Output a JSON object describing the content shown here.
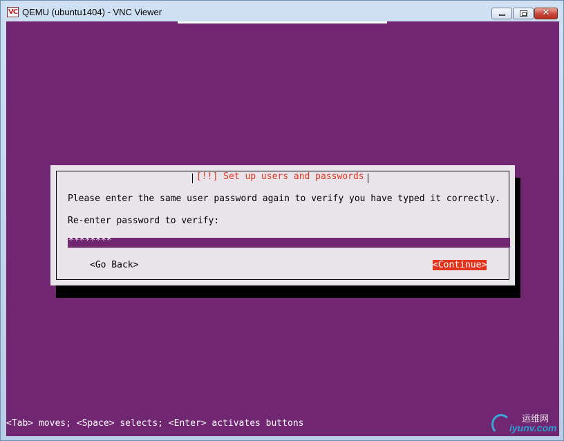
{
  "window": {
    "app_icon_text": "VC",
    "title": "QEMU (ubuntu1404) - VNC Viewer",
    "controls": {
      "minimize": "minimize",
      "maximize": "maximize",
      "close": "✕"
    }
  },
  "dialog": {
    "title": "[!!] Set up users and passwords",
    "prompt": "Please enter the same user password again to verify you have typed it correctly.",
    "field_label": "Re-enter password to verify:",
    "password_value": "********",
    "buttons": {
      "back": "<Go Back>",
      "continue": "<Continue>"
    }
  },
  "help_bar": "<Tab> moves; <Space> selects; <Enter> activates buttons",
  "watermark": {
    "text_cn": "运维网",
    "url": "iyunv.com"
  },
  "colors": {
    "background": "#712672",
    "dialog_bg": "#e9e4e9",
    "accent": "#e3351e"
  }
}
